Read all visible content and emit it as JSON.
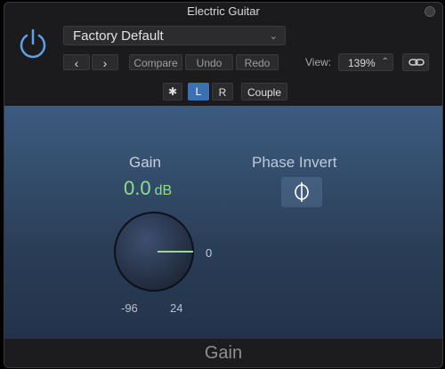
{
  "window": {
    "title": "Electric Guitar"
  },
  "header": {
    "preset": "Factory Default",
    "compare_label": "Compare",
    "undo_label": "Undo",
    "redo_label": "Redo",
    "view_label": "View:",
    "view_zoom": "139%",
    "channel_left": "L",
    "channel_right": "R",
    "couple_label": "Couple",
    "icons": [
      "power-icon",
      "chevron-down-icon",
      "chevron-left-icon",
      "chevron-right-icon",
      "link-icon",
      "gear-icon",
      "phase-invert-icon"
    ]
  },
  "plugin": {
    "gain_title": "Gain",
    "gain_value": "0.0",
    "gain_unit": "dB",
    "gain_zero_label": "0",
    "gain_min": "-96",
    "gain_max": "24",
    "phase_title": "Phase Invert",
    "footer_title": "Gain",
    "accent_color": "#8ae08a",
    "channel_active_color": "#3c6fb3"
  }
}
